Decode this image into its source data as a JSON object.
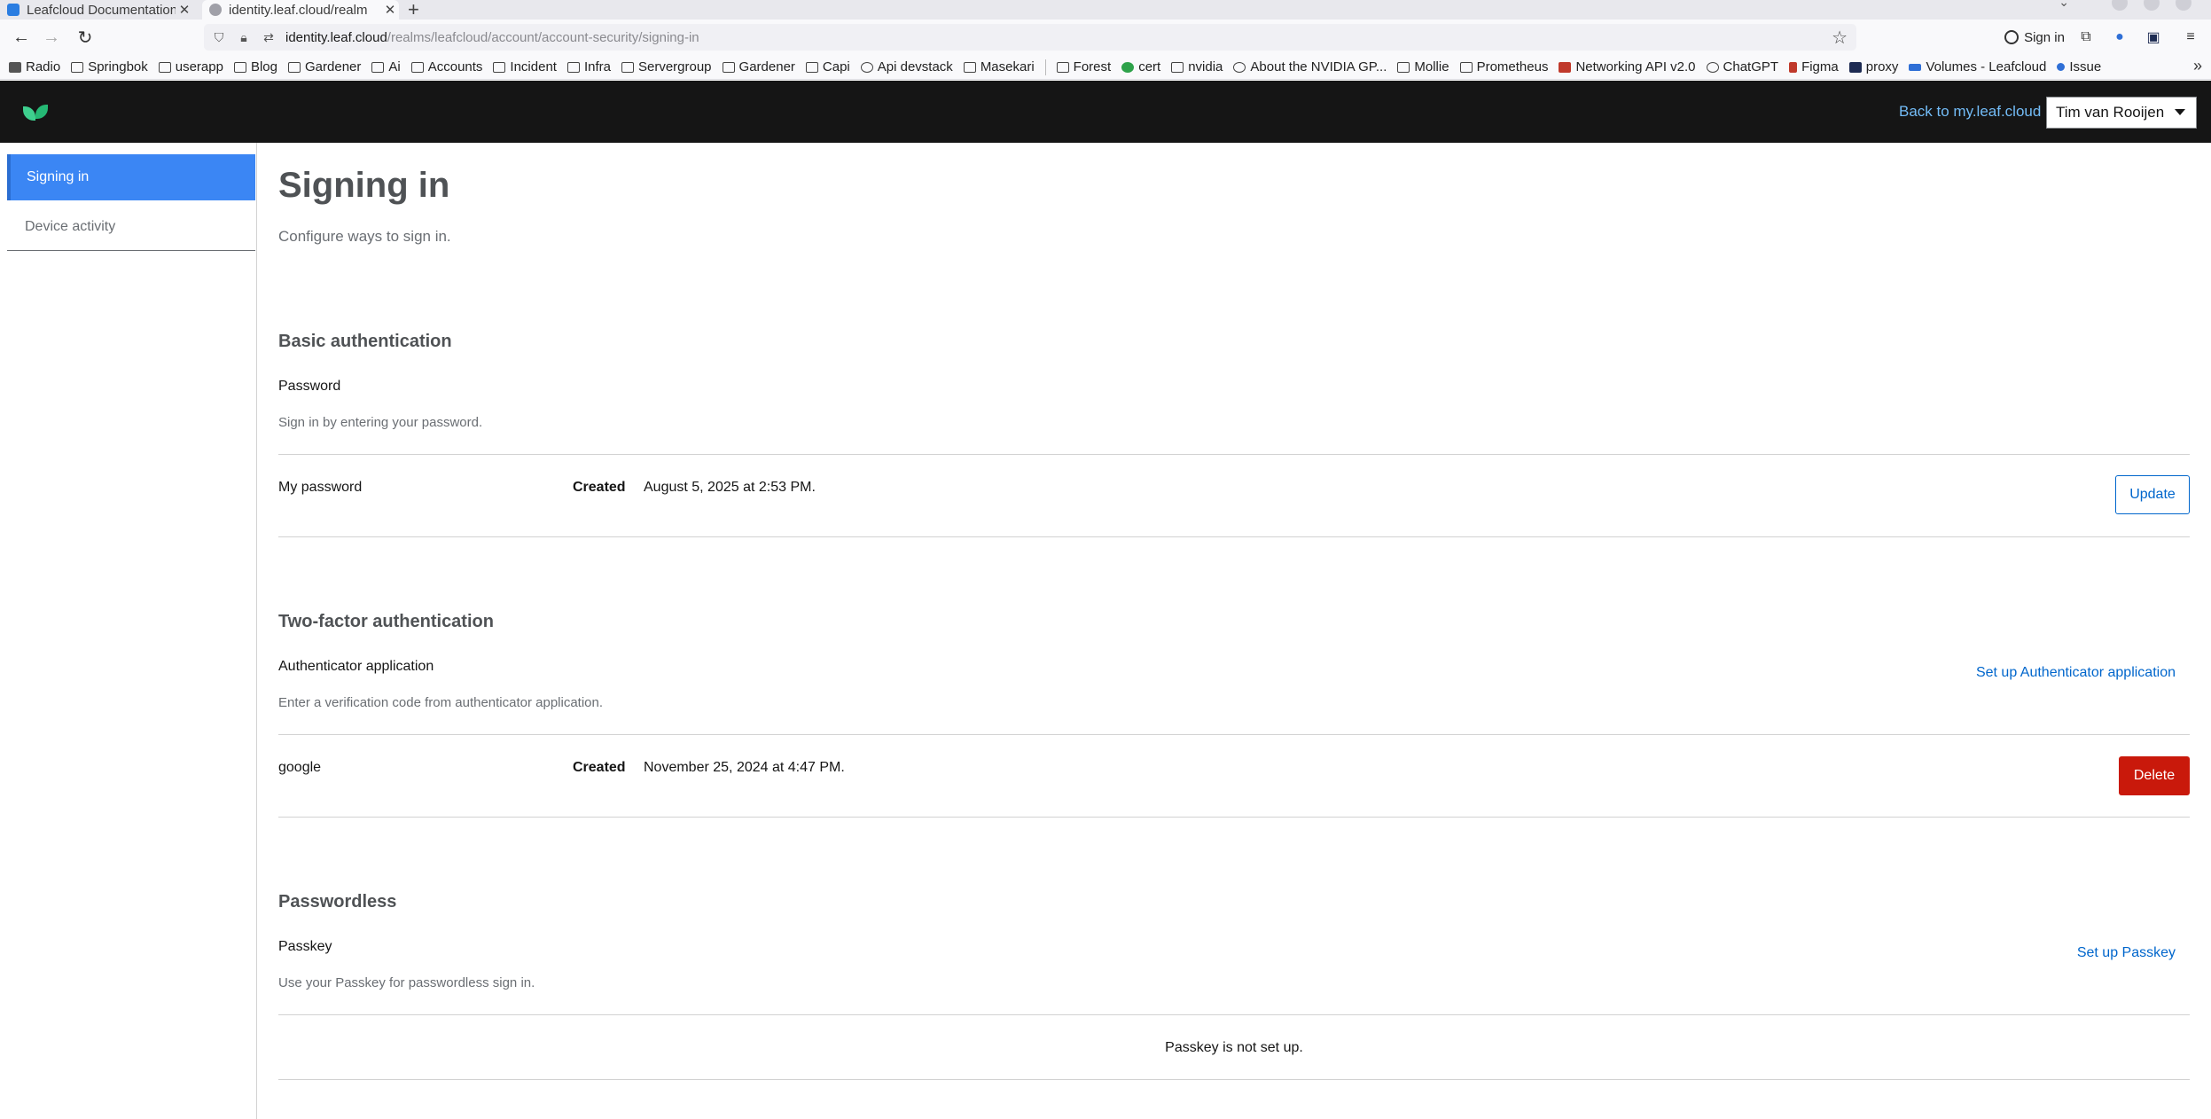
{
  "browser": {
    "tabs": [
      {
        "title": "Leafcloud Documentation",
        "favicon_color": "#2a7de1"
      },
      {
        "title": "identity.leaf.cloud/realm",
        "favicon_color": "#a0a0a8"
      }
    ],
    "url_domain": "identity.leaf.cloud",
    "url_prefix": "",
    "url_path": "/realms/leafcloud/account/account-security/signing-in",
    "signin_label": "Sign in",
    "bookmarks": [
      {
        "label": "Radio",
        "icon": "radio-icon"
      },
      {
        "label": "Springbok",
        "icon": "folder-icon"
      },
      {
        "label": "userapp",
        "icon": "folder-icon"
      },
      {
        "label": "Blog",
        "icon": "folder-icon"
      },
      {
        "label": "Gardener",
        "icon": "folder-icon"
      },
      {
        "label": "Ai",
        "icon": "folder-icon"
      },
      {
        "label": "Accounts",
        "icon": "folder-icon"
      },
      {
        "label": "Incident",
        "icon": "folder-icon"
      },
      {
        "label": "Infra",
        "icon": "folder-icon"
      },
      {
        "label": "Servergroup",
        "icon": "folder-icon"
      },
      {
        "label": "Gardener",
        "icon": "folder-icon"
      },
      {
        "label": "Capi",
        "icon": "folder-icon"
      },
      {
        "label": "Api devstack",
        "icon": "globe-icon"
      },
      {
        "label": "Masekari",
        "icon": "folder-icon"
      },
      {
        "label": "Forest",
        "icon": "folder-icon"
      },
      {
        "label": "cert",
        "icon": "shield-icon"
      },
      {
        "label": "nvidia",
        "icon": "folder-icon"
      },
      {
        "label": "About the NVIDIA GP...",
        "icon": "globe-icon"
      },
      {
        "label": "Mollie",
        "icon": "folder-icon"
      },
      {
        "label": "Prometheus",
        "icon": "folder-icon"
      },
      {
        "label": "Networking API v2.0",
        "icon": "openstack-icon"
      },
      {
        "label": "ChatGPT",
        "icon": "chatgpt-icon"
      },
      {
        "label": "Figma",
        "icon": "figma-icon"
      },
      {
        "label": "proxy",
        "icon": "proxy-icon"
      },
      {
        "label": "Volumes - Leafcloud",
        "icon": "leafcloud-icon"
      },
      {
        "label": "Issue",
        "icon": "issue-icon"
      }
    ]
  },
  "header": {
    "back_link": "Back to my.leaf.cloud",
    "user_name": "Tim van Rooijen"
  },
  "sidebar": {
    "items": [
      {
        "label": "Signing in",
        "active": true
      },
      {
        "label": "Device activity",
        "active": false
      }
    ]
  },
  "main": {
    "title": "Signing in",
    "subtitle": "Configure ways to sign in.",
    "basic": {
      "title": "Basic authentication",
      "cred_title": "Password",
      "cred_help": "Sign in by entering your password.",
      "row_label": "My password",
      "created_label": "Created",
      "created_date": "August 5, 2025 at 2:53 PM.",
      "update_label": "Update"
    },
    "twofactor": {
      "title": "Two-factor authentication",
      "cred_title": "Authenticator application",
      "cred_help": "Enter a verification code from authenticator application.",
      "setup_label": "Set up Authenticator application",
      "row_label": "google",
      "created_label": "Created",
      "created_date": "November 25, 2024 at 4:47 PM.",
      "delete_label": "Delete"
    },
    "passwordless": {
      "title": "Passwordless",
      "cred_title": "Passkey",
      "cred_help": "Use your Passkey for passwordless sign in.",
      "setup_label": "Set up Passkey",
      "empty_message": "Passkey is not set up."
    }
  },
  "colors": {
    "masthead": "#151515",
    "active_nav": "#3b86f4",
    "link": "#0066cc",
    "danger": "#c9190b",
    "logo": "#3ecf8e"
  }
}
